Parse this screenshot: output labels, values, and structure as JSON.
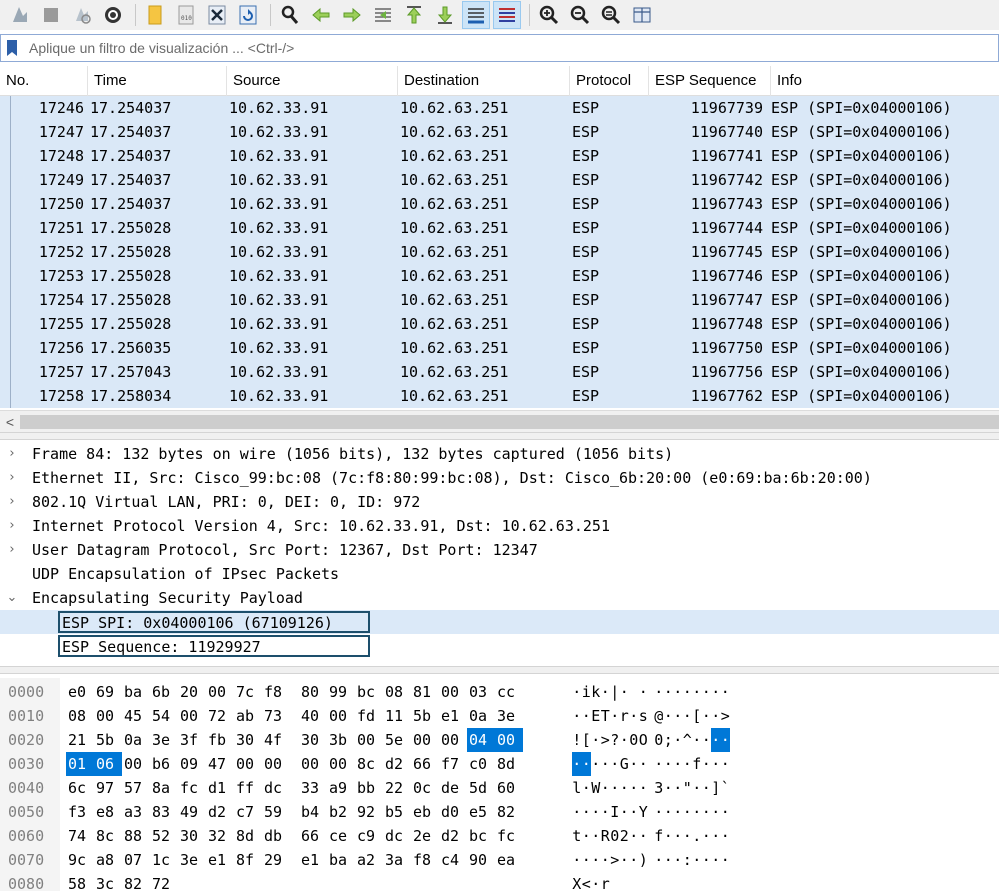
{
  "toolbar": {
    "buttons": [
      {
        "name": "start-capture-icon"
      },
      {
        "name": "stop-capture-icon"
      },
      {
        "name": "restart-capture-icon"
      },
      {
        "name": "capture-options-icon"
      },
      {
        "name": "open-file-icon"
      },
      {
        "name": "save-file-icon"
      },
      {
        "name": "close-file-icon"
      },
      {
        "name": "reload-file-icon"
      },
      {
        "name": "find-packet-icon"
      },
      {
        "name": "go-back-icon"
      },
      {
        "name": "go-forward-icon"
      },
      {
        "name": "go-to-packet-icon"
      },
      {
        "name": "go-first-packet-icon"
      },
      {
        "name": "go-last-packet-icon"
      },
      {
        "name": "autoscroll-icon"
      },
      {
        "name": "colorize-icon"
      },
      {
        "name": "zoom-in-icon"
      },
      {
        "name": "zoom-out-icon"
      },
      {
        "name": "zoom-normal-icon"
      },
      {
        "name": "resize-columns-icon"
      }
    ]
  },
  "filter": {
    "placeholder": "Aplique un filtro de visualización ... <Ctrl-/>"
  },
  "packet_list": {
    "columns": [
      "No.",
      "Time",
      "Source",
      "Destination",
      "Protocol",
      "ESP Sequence",
      "Info"
    ],
    "rows": [
      {
        "no": "17246",
        "time": "17.254037",
        "src": "10.62.33.91",
        "dst": "10.62.63.251",
        "proto": "ESP",
        "seq": "11967739",
        "info": "ESP (SPI=0x04000106)"
      },
      {
        "no": "17247",
        "time": "17.254037",
        "src": "10.62.33.91",
        "dst": "10.62.63.251",
        "proto": "ESP",
        "seq": "11967740",
        "info": "ESP (SPI=0x04000106)"
      },
      {
        "no": "17248",
        "time": "17.254037",
        "src": "10.62.33.91",
        "dst": "10.62.63.251",
        "proto": "ESP",
        "seq": "11967741",
        "info": "ESP (SPI=0x04000106)"
      },
      {
        "no": "17249",
        "time": "17.254037",
        "src": "10.62.33.91",
        "dst": "10.62.63.251",
        "proto": "ESP",
        "seq": "11967742",
        "info": "ESP (SPI=0x04000106)"
      },
      {
        "no": "17250",
        "time": "17.254037",
        "src": "10.62.33.91",
        "dst": "10.62.63.251",
        "proto": "ESP",
        "seq": "11967743",
        "info": "ESP (SPI=0x04000106)"
      },
      {
        "no": "17251",
        "time": "17.255028",
        "src": "10.62.33.91",
        "dst": "10.62.63.251",
        "proto": "ESP",
        "seq": "11967744",
        "info": "ESP (SPI=0x04000106)"
      },
      {
        "no": "17252",
        "time": "17.255028",
        "src": "10.62.33.91",
        "dst": "10.62.63.251",
        "proto": "ESP",
        "seq": "11967745",
        "info": "ESP (SPI=0x04000106)"
      },
      {
        "no": "17253",
        "time": "17.255028",
        "src": "10.62.33.91",
        "dst": "10.62.63.251",
        "proto": "ESP",
        "seq": "11967746",
        "info": "ESP (SPI=0x04000106)"
      },
      {
        "no": "17254",
        "time": "17.255028",
        "src": "10.62.33.91",
        "dst": "10.62.63.251",
        "proto": "ESP",
        "seq": "11967747",
        "info": "ESP (SPI=0x04000106)"
      },
      {
        "no": "17255",
        "time": "17.255028",
        "src": "10.62.33.91",
        "dst": "10.62.63.251",
        "proto": "ESP",
        "seq": "11967748",
        "info": "ESP (SPI=0x04000106)"
      },
      {
        "no": "17256",
        "time": "17.256035",
        "src": "10.62.33.91",
        "dst": "10.62.63.251",
        "proto": "ESP",
        "seq": "11967750",
        "info": "ESP (SPI=0x04000106)"
      },
      {
        "no": "17257",
        "time": "17.257043",
        "src": "10.62.33.91",
        "dst": "10.62.63.251",
        "proto": "ESP",
        "seq": "11967756",
        "info": "ESP (SPI=0x04000106)"
      },
      {
        "no": "17258",
        "time": "17.258034",
        "src": "10.62.33.91",
        "dst": "10.62.63.251",
        "proto": "ESP",
        "seq": "11967762",
        "info": "ESP (SPI=0x04000106)"
      }
    ]
  },
  "details": {
    "items": [
      {
        "arrow": "›",
        "text": "Frame 84: 132 bytes on wire (1056 bits), 132 bytes captured (1056 bits)"
      },
      {
        "arrow": "›",
        "text": "Ethernet II, Src: Cisco_99:bc:08 (7c:f8:80:99:bc:08), Dst: Cisco_6b:20:00 (e0:69:ba:6b:20:00)"
      },
      {
        "arrow": "›",
        "text": "802.1Q Virtual LAN, PRI: 0, DEI: 0, ID: 972"
      },
      {
        "arrow": "›",
        "text": "Internet Protocol Version 4, Src: 10.62.33.91, Dst: 10.62.63.251"
      },
      {
        "arrow": "›",
        "text": "User Datagram Protocol, Src Port: 12367, Dst Port: 12347"
      },
      {
        "arrow": "",
        "text": "UDP Encapsulation of IPsec Packets"
      },
      {
        "arrow": "⌄",
        "text": "Encapsulating Security Payload"
      }
    ],
    "esp_spi": "ESP SPI: 0x04000106 (67109126)",
    "esp_sequence": "ESP Sequence: 11929927"
  },
  "hex": {
    "rows": [
      {
        "offset": "0000",
        "bytes": [
          "e0",
          "69",
          "ba",
          "6b",
          "20",
          "00",
          "7c",
          "f8",
          "80",
          "99",
          "bc",
          "08",
          "81",
          "00",
          "03",
          "cc"
        ],
        "ascii": [
          "·",
          "i",
          "k",
          "·",
          "|",
          "·",
          " ",
          "·",
          "·",
          "·",
          "·",
          "·",
          "·",
          "·",
          "·",
          "·"
        ],
        "hl": []
      },
      {
        "offset": "0010",
        "bytes": [
          "08",
          "00",
          "45",
          "54",
          "00",
          "72",
          "ab",
          "73",
          "40",
          "00",
          "fd",
          "11",
          "5b",
          "e1",
          "0a",
          "3e"
        ],
        "ascii": [
          "·",
          "·",
          "E",
          "T",
          "·",
          "r",
          "·",
          "s",
          "@",
          "·",
          "·",
          "·",
          "[",
          "·",
          "·",
          ">"
        ],
        "hl": []
      },
      {
        "offset": "0020",
        "bytes": [
          "21",
          "5b",
          "0a",
          "3e",
          "3f",
          "fb",
          "30",
          "4f",
          "30",
          "3b",
          "00",
          "5e",
          "00",
          "00",
          "04",
          "00"
        ],
        "ascii": [
          "!",
          "[",
          "·",
          ">",
          "?",
          "·",
          "0",
          "O",
          "0",
          ";",
          "·",
          "^",
          "·",
          "·",
          "·",
          "·"
        ],
        "hl": [
          14,
          15
        ]
      },
      {
        "offset": "0030",
        "bytes": [
          "01",
          "06",
          "00",
          "b6",
          "09",
          "47",
          "00",
          "00",
          "00",
          "00",
          "8c",
          "d2",
          "66",
          "f7",
          "c0",
          "8d"
        ],
        "ascii": [
          "·",
          "·",
          "·",
          "·",
          "·",
          "G",
          "·",
          "·",
          "·",
          "·",
          "·",
          "·",
          "f",
          "·",
          "·",
          "·"
        ],
        "hl": [
          0,
          1
        ]
      },
      {
        "offset": "0040",
        "bytes": [
          "6c",
          "97",
          "57",
          "8a",
          "fc",
          "d1",
          "ff",
          "dc",
          "33",
          "a9",
          "bb",
          "22",
          "0c",
          "de",
          "5d",
          "60"
        ],
        "ascii": [
          "l",
          "·",
          "W",
          "·",
          "·",
          "·",
          "·",
          "·",
          "3",
          "·",
          "·",
          "\"",
          "·",
          "·",
          "]",
          "`"
        ],
        "hl": []
      },
      {
        "offset": "0050",
        "bytes": [
          "f3",
          "e8",
          "a3",
          "83",
          "49",
          "d2",
          "c7",
          "59",
          "b4",
          "b2",
          "92",
          "b5",
          "eb",
          "d0",
          "e5",
          "82"
        ],
        "ascii": [
          "·",
          "·",
          "·",
          "·",
          "I",
          "·",
          "·",
          "Y",
          "·",
          "·",
          "·",
          "·",
          "·",
          "·",
          "·",
          "·"
        ],
        "hl": []
      },
      {
        "offset": "0060",
        "bytes": [
          "74",
          "8c",
          "88",
          "52",
          "30",
          "32",
          "8d",
          "db",
          "66",
          "ce",
          "c9",
          "dc",
          "2e",
          "d2",
          "bc",
          "fc"
        ],
        "ascii": [
          "t",
          "·",
          "·",
          "R",
          "0",
          "2",
          "·",
          "·",
          "f",
          "·",
          "·",
          "·",
          ".",
          "·",
          "·",
          "·"
        ],
        "hl": []
      },
      {
        "offset": "0070",
        "bytes": [
          "9c",
          "a8",
          "07",
          "1c",
          "3e",
          "e1",
          "8f",
          "29",
          "e1",
          "ba",
          "a2",
          "3a",
          "f8",
          "c4",
          "90",
          "ea"
        ],
        "ascii": [
          "·",
          "·",
          "·",
          "·",
          ">",
          "·",
          "·",
          ")",
          "·",
          "·",
          "·",
          ":",
          "·",
          "·",
          "·",
          "·"
        ],
        "hl": []
      },
      {
        "offset": "0080",
        "bytes": [
          "58",
          "3c",
          "82",
          "72"
        ],
        "ascii": [
          "X",
          "<",
          "·",
          "r"
        ],
        "hl": []
      }
    ]
  },
  "colors": {
    "row_bg": "#dae8f7",
    "selection": "#0078d7",
    "tree_box": "#1d4f6c"
  }
}
